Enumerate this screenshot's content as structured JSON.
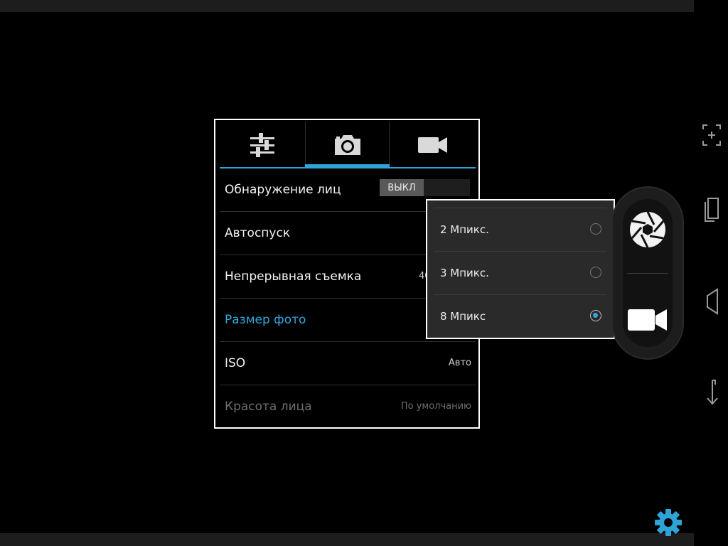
{
  "tabs": [
    {
      "name": "tab-general-settings",
      "icon": "sliders-icon"
    },
    {
      "name": "tab-photo-settings",
      "icon": "camera-icon",
      "active": true
    },
    {
      "name": "tab-video-settings",
      "icon": "video-camera-icon"
    }
  ],
  "settings": {
    "face_detection": {
      "label": "Обнаружение лиц",
      "toggle": "ВЫКЛ"
    },
    "self_timer": {
      "label": "Автоспуск"
    },
    "burst_shot": {
      "label": "Непрерывная съемка",
      "value": "40"
    },
    "photo_size": {
      "label": "Размер фото"
    },
    "iso": {
      "label": "ISO",
      "value": "Авто"
    },
    "face_beauty": {
      "label": "Красота лица",
      "value": "По умолчанию"
    }
  },
  "photo_size_options": [
    {
      "label": "2 Мпикс.",
      "selected": false
    },
    {
      "label": "3 Мпикс.",
      "selected": false
    },
    {
      "label": "8 Мпикс",
      "selected": true
    }
  ],
  "colors": {
    "accent": "#33a6dd",
    "background": "#000000",
    "popup_bg": "#2a2a2a"
  },
  "shutter": {
    "photo_icon": "aperture-icon",
    "video_icon": "video-camera-icon"
  },
  "nav": [
    "focus-icon",
    "recent-apps-icon",
    "back-icon",
    "rotate-icon"
  ],
  "settings_button_icon": "gear-icon"
}
